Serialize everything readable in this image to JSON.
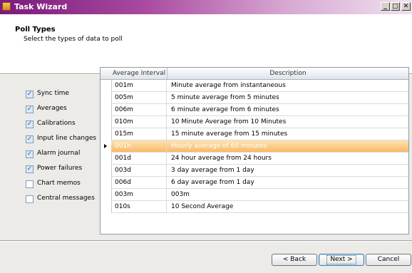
{
  "window": {
    "title": "Task Wizard"
  },
  "header": {
    "title": "Poll Types",
    "subtitle": "Select the types of data to poll"
  },
  "options": [
    {
      "label": "Sync time",
      "checked": true
    },
    {
      "label": "Averages",
      "checked": true
    },
    {
      "label": "Calibrations",
      "checked": true
    },
    {
      "label": "Input line changes",
      "checked": true
    },
    {
      "label": "Alarm journal",
      "checked": true
    },
    {
      "label": "Power failures",
      "checked": true
    },
    {
      "label": "Chart memos",
      "checked": false
    },
    {
      "label": "Central messages",
      "checked": false
    }
  ],
  "grid": {
    "columns": [
      "Average Interval",
      "Description"
    ],
    "rows": [
      {
        "interval": "001m",
        "description": "Minute average from instantaneous"
      },
      {
        "interval": "005m",
        "description": "5 minute average from 5 minutes"
      },
      {
        "interval": "006m",
        "description": "6 minute average from 6 minutes"
      },
      {
        "interval": "010m",
        "description": "10 Minute Average from 10 Minutes"
      },
      {
        "interval": "015m",
        "description": "15 minute average from 15 minutes"
      },
      {
        "interval": "001h",
        "description": "Hourly average of 60 minutes",
        "selected": true
      },
      {
        "interval": "001d",
        "description": "24 hour average from 24 hours"
      },
      {
        "interval": "003d",
        "description": "3 day average from 1 day"
      },
      {
        "interval": "006d",
        "description": "6 day average from 1 day"
      },
      {
        "interval": "003m",
        "description": "003m"
      },
      {
        "interval": "010s",
        "description": "10 Second Average"
      }
    ]
  },
  "buttons": {
    "back": "< Back",
    "next": "Next >",
    "cancel": "Cancel"
  },
  "colors": {
    "selection": "#f9b964",
    "title_gradient_start": "#7a1a7a"
  }
}
